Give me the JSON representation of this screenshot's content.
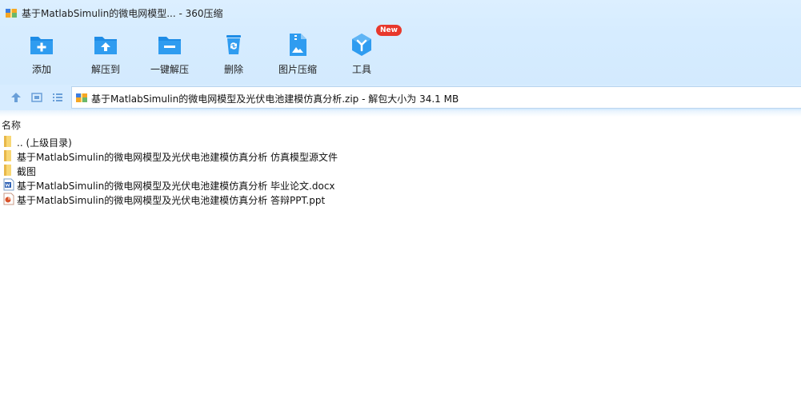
{
  "window": {
    "title": "基于MatlabSimulin的微电网模型... - 360压缩"
  },
  "toolbar": {
    "items": [
      {
        "label": "添加",
        "icon": "add-icon"
      },
      {
        "label": "解压到",
        "icon": "extract-to-icon"
      },
      {
        "label": "一键解压",
        "icon": "one-click-extract-icon"
      },
      {
        "label": "删除",
        "icon": "delete-icon"
      },
      {
        "label": "图片压缩",
        "icon": "image-compress-icon"
      },
      {
        "label": "工具",
        "icon": "tools-icon",
        "badge": "New"
      }
    ]
  },
  "address": {
    "path": "基于MatlabSimulin的微电网模型及光伏电池建模仿真分析.zip - 解包大小为 34.1 MB"
  },
  "list": {
    "column_name": "名称",
    "rows": [
      {
        "name": ".. (上级目录)",
        "type": "parent-folder"
      },
      {
        "name": "基于MatlabSimulin的微电网模型及光伏电池建模仿真分析 仿真模型源文件",
        "type": "folder"
      },
      {
        "name": "截图",
        "type": "folder"
      },
      {
        "name": "基于MatlabSimulin的微电网模型及光伏电池建模仿真分析 毕业论文.docx",
        "type": "docx"
      },
      {
        "name": "基于MatlabSimulin的微电网模型及光伏电池建模仿真分析 答辩PPT.ppt",
        "type": "ppt"
      }
    ]
  },
  "colors": {
    "accent": "#1e8ce6",
    "toolbar_bg": "#d6ecff",
    "badge": "#e8382c"
  }
}
